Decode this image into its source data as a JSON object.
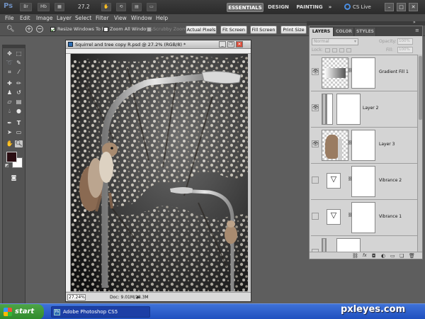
{
  "app": {
    "logo": "Ps",
    "icons": [
      "Br",
      "Mb"
    ],
    "zoom": "27.2",
    "workspaces": [
      "ESSENTIALS",
      "DESIGN",
      "PAINTING"
    ],
    "more": "»",
    "cs_live": "CS Live"
  },
  "menu": [
    "File",
    "Edit",
    "Image",
    "Layer",
    "Select",
    "Filter",
    "View",
    "Window",
    "Help"
  ],
  "options": {
    "resize_windows": {
      "label": "Resize Windows To Fit",
      "checked": true
    },
    "zoom_all": {
      "label": "Zoom All Windows",
      "checked": false
    },
    "scrubby": {
      "label": "Scrubby Zoom",
      "checked": false,
      "enabled": false
    },
    "buttons": [
      "Actual Pixels",
      "Fit Screen",
      "Fill Screen",
      "Print Size"
    ]
  },
  "document": {
    "title": "Squirrel and tree copy R.psd @ 27.2% (RGB/8) *",
    "zoom": "27.24%",
    "info": "Doc: 9.01M/28.3M"
  },
  "colors": {
    "foreground": "#2a0d12",
    "background": "#ffffff",
    "accent": "#3b6bd1"
  },
  "panel": {
    "tabs": [
      "LAYERS",
      "COLOR",
      "STYLES"
    ],
    "blend_mode": "Normal",
    "opacity_label": "Opacity:",
    "opacity": "100%",
    "lock_label": "Lock:",
    "fill_label": "Fill:",
    "fill": "100%",
    "layers": [
      {
        "name": "Gradient Fill 1",
        "visible": true,
        "type": "gradient"
      },
      {
        "name": "Layer 2",
        "visible": true,
        "type": "pole"
      },
      {
        "name": "Layer 3",
        "visible": true,
        "type": "squirrel"
      },
      {
        "name": "Vibrance 2",
        "visible": false,
        "type": "adjustment"
      },
      {
        "name": "Vibrance 1",
        "visible": false,
        "type": "adjustment"
      },
      {
        "name": "",
        "visible": false,
        "type": "pole"
      }
    ],
    "bottom_icons": [
      "link-icon",
      "fx-icon",
      "mask-icon",
      "adjustment-icon",
      "group-icon",
      "new-layer-icon",
      "trash-icon"
    ]
  },
  "taskbar": {
    "start": "start",
    "item": "Adobe Photoshop CS5",
    "watermark": "pxleyes.com"
  }
}
